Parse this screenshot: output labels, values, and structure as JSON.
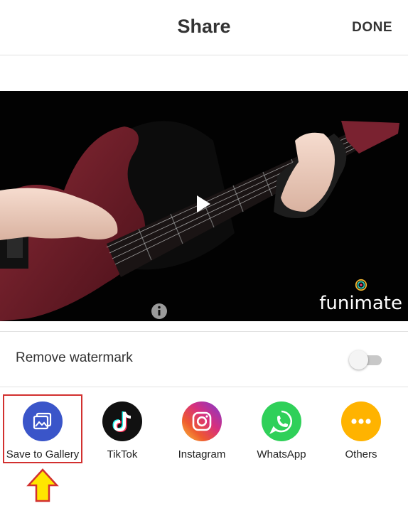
{
  "header": {
    "title": "Share",
    "done_label": "DONE"
  },
  "video": {
    "brand_wordmark": "funimate",
    "play_icon": "play-icon",
    "info_icon": "info-icon"
  },
  "watermark": {
    "label": "Remove watermark",
    "enabled": false
  },
  "share_targets": [
    {
      "label": "Save to Gallery",
      "icon": "gallery-icon",
      "color": "#3a55c9",
      "selected": true
    },
    {
      "label": "TikTok",
      "icon": "tiktok-icon",
      "color": "#111111"
    },
    {
      "label": "Instagram",
      "icon": "instagram-icon",
      "color": "#d62f7f"
    },
    {
      "label": "WhatsApp",
      "icon": "whatsapp-icon",
      "color": "#2fd059"
    },
    {
      "label": "Others",
      "icon": "more-icon",
      "color": "#ffb300"
    }
  ],
  "colors": {
    "highlight_border": "#d2302f",
    "arrow_fill": "#ffe600",
    "arrow_stroke": "#d2302f"
  }
}
